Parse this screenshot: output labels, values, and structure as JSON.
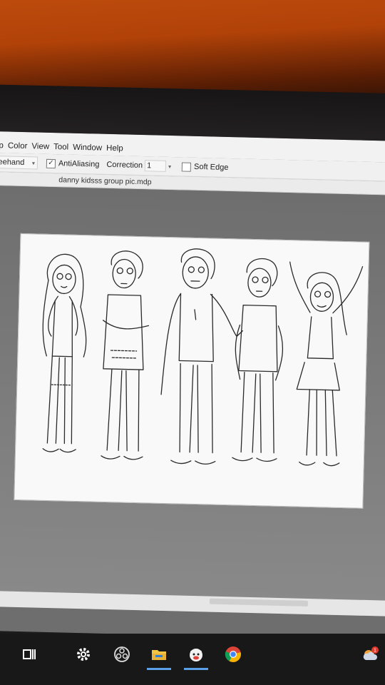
{
  "menu": {
    "items": [
      "p",
      "Color",
      "View",
      "Tool",
      "Window",
      "Help"
    ]
  },
  "toolbar": {
    "brush_mode": "reehand",
    "antialias_label": "AntiAliasing",
    "antialias_checked": true,
    "correction_label": "Correction",
    "correction_value": "1",
    "soft_edge_label": "Soft Edge",
    "soft_edge_checked": false
  },
  "document": {
    "tab_title": "danny kidsss group pic.mdp"
  },
  "taskbar": {
    "items": [
      {
        "icon": "task-view-icon",
        "active": false
      },
      {
        "icon": "settings-gear-icon",
        "active": false
      },
      {
        "icon": "obs-studio-icon",
        "active": false
      },
      {
        "icon": "file-explorer-icon",
        "active": true
      },
      {
        "icon": "medibang-paint-icon",
        "active": true
      },
      {
        "icon": "chrome-icon",
        "active": false
      },
      {
        "icon": "cloud-weather-icon",
        "badge": "1",
        "active": false
      }
    ]
  },
  "colors": {
    "accent": "#5aa0e8",
    "badge": "#e23a2e"
  }
}
